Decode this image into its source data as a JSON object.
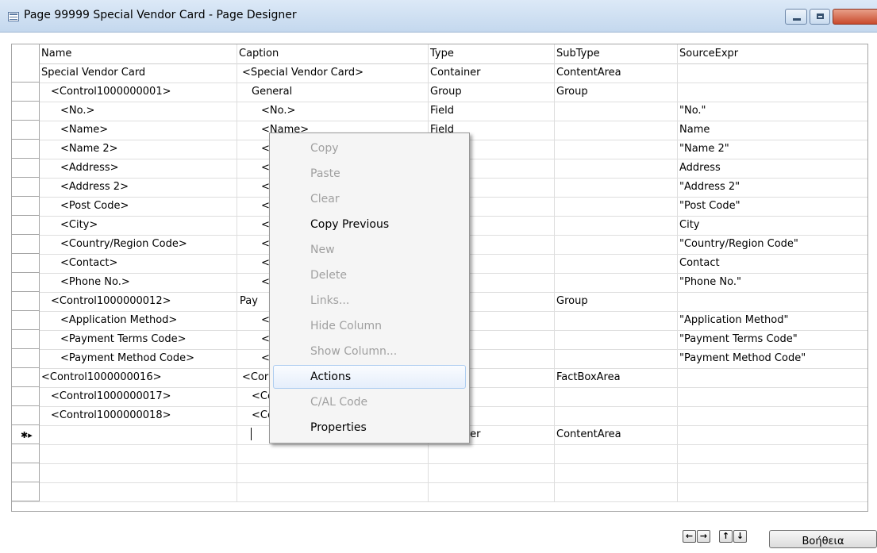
{
  "window": {
    "title": "Page 99999 Special Vendor Card - Page Designer"
  },
  "columns": {
    "name": "Name",
    "caption": "Caption",
    "type": "Type",
    "subtype": "SubType",
    "source": "SourceExpr"
  },
  "rows": [
    {
      "name": "Special Vendor Card",
      "caption": "<Special Vendor Card>",
      "type": "Container",
      "subtype": "ContentArea",
      "source": ""
    },
    {
      "name": "<Control1000000001>",
      "caption": "General",
      "type": "Group",
      "subtype": "Group",
      "source": ""
    },
    {
      "name": "<No.>",
      "caption": "<No.>",
      "type": "Field",
      "subtype": "",
      "source": "\"No.\""
    },
    {
      "name": "<Name>",
      "caption": "<Name>",
      "type": "Field",
      "subtype": "",
      "source": "Name"
    },
    {
      "name": "<Name 2>",
      "caption": "<",
      "type": "",
      "subtype": "",
      "source": "\"Name 2\""
    },
    {
      "name": "<Address>",
      "caption": "<",
      "type": "",
      "subtype": "",
      "source": "Address"
    },
    {
      "name": "<Address 2>",
      "caption": "<",
      "type": "",
      "subtype": "",
      "source": "\"Address 2\""
    },
    {
      "name": "<Post Code>",
      "caption": "<",
      "type": "",
      "subtype": "",
      "source": "\"Post Code\""
    },
    {
      "name": "<City>",
      "caption": "<",
      "type": "",
      "subtype": "",
      "source": "City"
    },
    {
      "name": "<Country/Region Code>",
      "caption": "<",
      "type": "",
      "subtype": "",
      "source": "\"Country/Region Code\""
    },
    {
      "name": "<Contact>",
      "caption": "<",
      "type": "",
      "subtype": "",
      "source": "Contact"
    },
    {
      "name": "<Phone No.>",
      "caption": "<",
      "type": "",
      "subtype": "",
      "source": "\"Phone No.\""
    },
    {
      "name": "<Control1000000012>",
      "caption": "Pay",
      "type": "",
      "subtype": "Group",
      "source": ""
    },
    {
      "name": "<Application Method>",
      "caption": "<",
      "type": "",
      "subtype": "",
      "source": "\"Application Method\""
    },
    {
      "name": "<Payment Terms Code>",
      "caption": "<",
      "type": "",
      "subtype": "",
      "source": "\"Payment Terms Code\""
    },
    {
      "name": "<Payment Method Code>",
      "caption": "<",
      "type": "",
      "subtype": "",
      "source": "\"Payment Method Code\""
    },
    {
      "name": "<Control1000000016>",
      "caption": "<Cor",
      "type": "ner",
      "subtype": "FactBoxArea",
      "source": ""
    },
    {
      "name": "<Control1000000017>",
      "caption": "<Cc",
      "type": "",
      "subtype": "",
      "source": ""
    },
    {
      "name": "<Control1000000018>",
      "caption": "<Cc",
      "type": "",
      "subtype": "",
      "source": ""
    },
    {
      "name": "",
      "caption": "",
      "type": "Container",
      "subtype": "ContentArea",
      "source": "",
      "marker": "✱▸"
    },
    {
      "name": "",
      "caption": "",
      "type": "",
      "subtype": "",
      "source": ""
    },
    {
      "name": "",
      "caption": "",
      "type": "",
      "subtype": "",
      "source": ""
    },
    {
      "name": "",
      "caption": "",
      "type": "",
      "subtype": "",
      "source": ""
    }
  ],
  "context_menu": [
    {
      "label": "Copy",
      "enabled": false
    },
    {
      "label": "Paste",
      "enabled": false
    },
    {
      "label": "Clear",
      "enabled": false
    },
    {
      "label": "Copy Previous",
      "enabled": true
    },
    {
      "label": "New",
      "enabled": false
    },
    {
      "label": "Delete",
      "enabled": false
    },
    {
      "label": "Links...",
      "enabled": false
    },
    {
      "label": "Hide Column",
      "enabled": false
    },
    {
      "label": "Show Column...",
      "enabled": false
    },
    {
      "label": "Actions",
      "enabled": true,
      "highlighted": true
    },
    {
      "label": "C/AL Code",
      "enabled": false
    },
    {
      "label": "Properties",
      "enabled": true
    }
  ],
  "footer": {
    "nav_left": "←",
    "nav_right": "→",
    "nav_up": "↑",
    "nav_down": "↓",
    "help_label": "Βοήθεια"
  }
}
